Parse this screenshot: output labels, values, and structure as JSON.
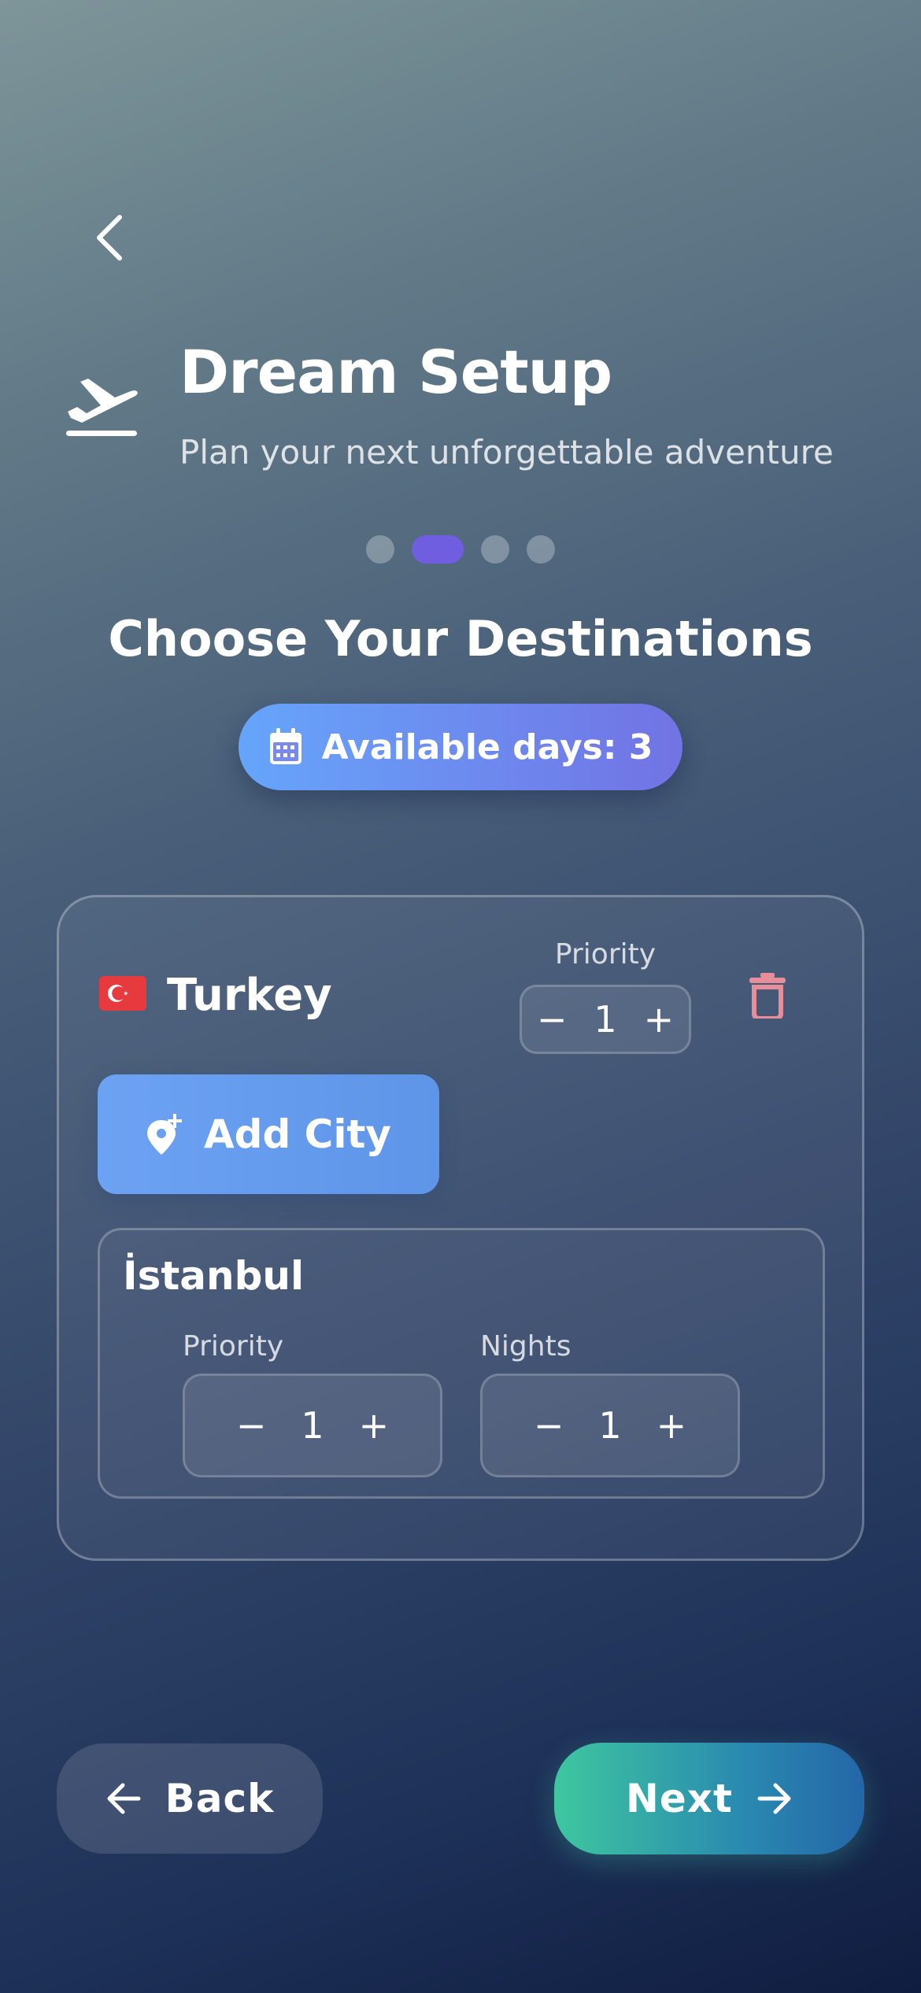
{
  "header": {
    "title": "Dream Setup",
    "subtitle": "Plan your next unforgettable adventure"
  },
  "steps": {
    "total": 4,
    "current": 2
  },
  "section": {
    "heading": "Choose Your Destinations",
    "available_days": "Available days: 3"
  },
  "country": {
    "flag": "🇹🇷",
    "name": "Turkey",
    "priority_label": "Priority",
    "priority_value": "1",
    "add_city_label": "Add City",
    "cities": [
      {
        "name": "İstanbul",
        "priority_label": "Priority",
        "priority_value": "1",
        "nights_label": "Nights",
        "nights_value": "1"
      }
    ]
  },
  "footer": {
    "back_label": "Back",
    "next_label": "Next"
  },
  "colors": {
    "accent_purple": "#6f5fe0",
    "pill_gradient_start": "#66a5fb",
    "pill_gradient_end": "#7273e4",
    "add_city_blue": "#6da2f3",
    "next_gradient_start": "#3ec79f",
    "next_gradient_end": "#2466a8",
    "trash_red": "#e88e9a",
    "flag_red": "#e63a3f"
  },
  "icons": [
    "chevron-left-icon",
    "plane-takeoff-icon",
    "calendar-icon",
    "trash-icon",
    "map-pin-plus-icon",
    "minus-icon",
    "plus-icon",
    "arrow-left-icon",
    "arrow-right-icon"
  ]
}
